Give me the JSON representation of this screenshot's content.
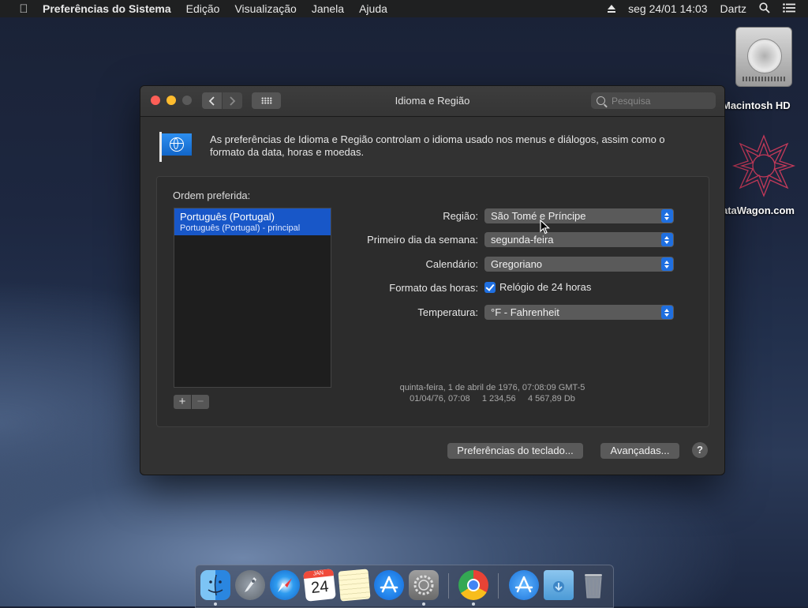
{
  "menubar": {
    "apple": "",
    "items": [
      "Preferências do Sistema",
      "Edição",
      "Visualização",
      "Janela",
      "Ajuda"
    ],
    "datetime": "seg 24/01 14:03",
    "user": "Dartz",
    "icons": [
      "eject-icon",
      "spotlight-search-icon",
      "notification-center-icon"
    ]
  },
  "desktop": {
    "hd_label": "Macintosh HD",
    "wagon_label": "ataWagon.com"
  },
  "window": {
    "title": "Idioma e Região",
    "search_placeholder": "Pesquisa",
    "intro": "As preferências de Idioma e Região controlam o idioma usado nos menus e diálogos, assim como o formato da data, horas e moedas.",
    "order_label": "Ordem preferida:",
    "languages": [
      {
        "name": "Português (Portugal)",
        "detail": "Português (Portugal) - principal"
      }
    ],
    "add_label": "+",
    "remove_label": "−",
    "settings": {
      "region_label": "Região:",
      "region_value": "São Tomé e Príncipe",
      "weekday_label": "Primeiro dia da semana:",
      "weekday_value": "segunda-feira",
      "calendar_label": "Calendário:",
      "calendar_value": "Gregoriano",
      "time_format_label": "Formato das horas:",
      "time_format_checkbox": "Relógio de 24 horas",
      "time_format_checked": true,
      "temperature_label": "Temperatura:",
      "temperature_value": "°F - Fahrenheit"
    },
    "sample_line1": "quinta-feira, 1 de abril de 1976, 07:08:09 GMT-5",
    "sample_line2": "01/04/76, 07:08     1 234,56     4 567,89 Db",
    "keyboard_button": "Preferências do teclado...",
    "advanced_button": "Avançadas...",
    "help_button": "?"
  },
  "dock": {
    "apps": [
      "finder-icon",
      "launchpad-icon",
      "safari-icon",
      "calendar-icon",
      "notes-icon",
      "app-store-icon",
      "system-preferences-icon",
      "chrome-icon",
      "applications-folder-icon",
      "downloads-folder-icon",
      "trash-icon"
    ],
    "calendar_month": "JAN",
    "calendar_day": "24"
  },
  "colors": {
    "accent": "#1f6fe0",
    "selection": "#1857c8",
    "window_bg": "#323232"
  }
}
